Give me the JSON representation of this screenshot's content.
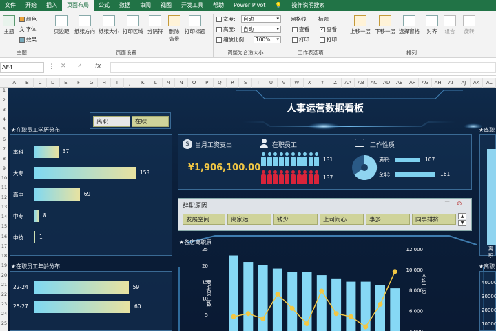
{
  "menu": {
    "tabs": [
      "文件",
      "开始",
      "插入",
      "页面布局",
      "公式",
      "数据",
      "审阅",
      "视图",
      "开发工具",
      "帮助",
      "Power Pivot",
      "操作说明搜索"
    ]
  },
  "ribbon": {
    "theme": {
      "main": "主题",
      "colors": "颜色",
      "fonts": "字体",
      "effects": "效果",
      "group": "主题"
    },
    "pagesetup": {
      "margins": "页边距",
      "orientation": "纸张方向",
      "size": "纸张大小",
      "printarea": "打印区域",
      "breaks": "分隔符",
      "background": "删除\n背景",
      "titles": "打印标题",
      "group": "页面设置"
    },
    "scale": {
      "width_label": "宽度:",
      "width_val": "自动",
      "height_label": "高度:",
      "height_val": "自动",
      "scale_label": "缩放比例:",
      "scale_val": "100%",
      "group": "调整为合适大小"
    },
    "sheet": {
      "gridlines": "网格线",
      "headings": "标题",
      "view1": "查看",
      "view2": "查看",
      "print1": "打印",
      "print2": "打印",
      "group": "工作表选项"
    },
    "arrange": {
      "forward": "上移一层",
      "backward": "下移一层",
      "pane": "选择窗格",
      "align": "对齐",
      "group_btn": "组合",
      "rotate": "旋转",
      "group": "排列"
    }
  },
  "namebox": "AF4",
  "fx": "fx",
  "columns": [
    "A",
    "B",
    "C",
    "D",
    "E",
    "F",
    "G",
    "H",
    "I",
    "J",
    "K",
    "L",
    "M",
    "N",
    "O",
    "P",
    "Q",
    "R",
    "S",
    "T",
    "U",
    "V",
    "W",
    "X",
    "Y",
    "Z",
    "AA",
    "AB",
    "AC",
    "AD",
    "AE",
    "AF",
    "AG",
    "AH",
    "AI",
    "AJ",
    "AK",
    "AL"
  ],
  "rows": [
    "1",
    "2",
    "3",
    "4",
    "5",
    "6",
    "7",
    "8",
    "9",
    "10",
    "11",
    "12",
    "13",
    "14",
    "15",
    "16",
    "17",
    "18",
    "19",
    "20",
    "21",
    "22",
    "23",
    "24",
    "25"
  ],
  "dashboard": {
    "title": "人事运营数据看板",
    "status_slicer": {
      "left": "离职",
      "right": "在职"
    },
    "edu": {
      "title": "★在职员工学历分布",
      "categories": [
        "本科",
        "大专",
        "高中",
        "中专",
        "中技"
      ],
      "values": [
        37,
        153,
        69,
        8,
        1
      ]
    },
    "age": {
      "title": "★在职员工年龄分布",
      "categories": [
        "22-24",
        "25-27"
      ],
      "values": [
        59,
        60
      ]
    },
    "salary": {
      "title": "当月工资支出",
      "value": "¥1,906,100.00"
    },
    "employees": {
      "title": "在职员工",
      "count_blue": "131",
      "count_red": "137"
    },
    "jobtype": {
      "title": "工作性质",
      "rows": [
        {
          "label": "满职:",
          "value": "107"
        },
        {
          "label": "全职:",
          "value": "161"
        }
      ]
    },
    "resign": {
      "title": "辞职原因",
      "items": [
        "发展空间",
        "离家远",
        "钱少",
        "上司闹心",
        "事多",
        "同事排挤"
      ]
    },
    "dept": {
      "title": "★各店离职原",
      "left_axis": [
        "25",
        "20",
        "15",
        "10",
        "5"
      ],
      "right_axis": [
        "12,000",
        "10,000",
        "8,000",
        "6,000",
        "4,000"
      ],
      "ylabel_left": "离职员工数",
      "ylabel_right": "人均工资"
    },
    "right_titles": [
      "★离职",
      "★离职"
    ],
    "right_label": "离职",
    "right_axis": [
      "40000",
      "30000",
      "20000",
      "10000"
    ]
  },
  "chart_data": [
    {
      "type": "bar",
      "title": "★在职员工学历分布",
      "categories": [
        "本科",
        "大专",
        "高中",
        "中专",
        "中技"
      ],
      "values": [
        37,
        153,
        69,
        8,
        1
      ]
    },
    {
      "type": "bar",
      "title": "★在职员工年龄分布",
      "categories": [
        "22-24",
        "25-27"
      ],
      "values": [
        59,
        60
      ]
    },
    {
      "type": "bar",
      "title": "★各店离职原",
      "series": [
        {
          "values": [
            23,
            21,
            20,
            19,
            18,
            18,
            17,
            16,
            15,
            15,
            14,
            13
          ]
        },
        {
          "values": [
            5400,
            5700,
            5200,
            7600,
            6200,
            4700,
            7900,
            5700,
            5400,
            4400,
            6600,
            9800
          ]
        }
      ],
      "ylim": [
        0,
        25
      ],
      "ylim_right": [
        4000,
        12000
      ]
    }
  ]
}
